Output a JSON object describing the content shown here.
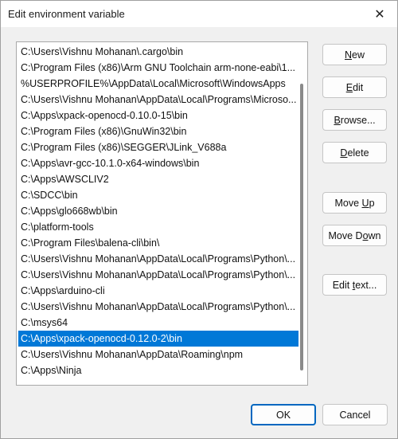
{
  "window": {
    "title": "Edit environment variable",
    "close_glyph": "✕"
  },
  "paths": [
    "C:\\Users\\Vishnu Mohanan\\.cargo\\bin",
    "C:\\Program Files (x86)\\Arm GNU Toolchain arm-none-eabi\\1...",
    "%USERPROFILE%\\AppData\\Local\\Microsoft\\WindowsApps",
    "C:\\Users\\Vishnu Mohanan\\AppData\\Local\\Programs\\Microso...",
    "C:\\Apps\\xpack-openocd-0.10.0-15\\bin",
    "C:\\Program Files (x86)\\GnuWin32\\bin",
    "C:\\Program Files (x86)\\SEGGER\\JLink_V688a",
    "C:\\Apps\\avr-gcc-10.1.0-x64-windows\\bin",
    "C:\\Apps\\AWSCLIV2",
    "C:\\SDCC\\bin",
    "C:\\Apps\\glo668wb\\bin",
    "C:\\platform-tools",
    "C:\\Program Files\\balena-cli\\bin\\",
    "C:\\Users\\Vishnu Mohanan\\AppData\\Local\\Programs\\Python\\...",
    "C:\\Users\\Vishnu Mohanan\\AppData\\Local\\Programs\\Python\\...",
    "C:\\Apps\\arduino-cli",
    "C:\\Users\\Vishnu Mohanan\\AppData\\Local\\Programs\\Python\\...",
    "C:\\msys64",
    "C:\\Apps\\xpack-openocd-0.12.0-2\\bin",
    "C:\\Users\\Vishnu Mohanan\\AppData\\Roaming\\npm",
    "C:\\Apps\\Ninja"
  ],
  "selected_index": 18,
  "buttons": {
    "new": {
      "pre": "",
      "key": "N",
      "post": "ew"
    },
    "edit": {
      "pre": "",
      "key": "E",
      "post": "dit"
    },
    "browse": {
      "pre": "",
      "key": "B",
      "post": "rowse..."
    },
    "delete": {
      "pre": "",
      "key": "D",
      "post": "elete"
    },
    "move_up": {
      "pre": "Move ",
      "key": "U",
      "post": "p"
    },
    "move_down": {
      "pre": "Move D",
      "key": "o",
      "post": "wn"
    },
    "edit_text": {
      "pre": "Edit ",
      "key": "t",
      "post": "ext..."
    },
    "ok": "OK",
    "cancel": "Cancel"
  },
  "colors": {
    "selection": "#0078d7",
    "default_button_border": "#0067c0"
  }
}
